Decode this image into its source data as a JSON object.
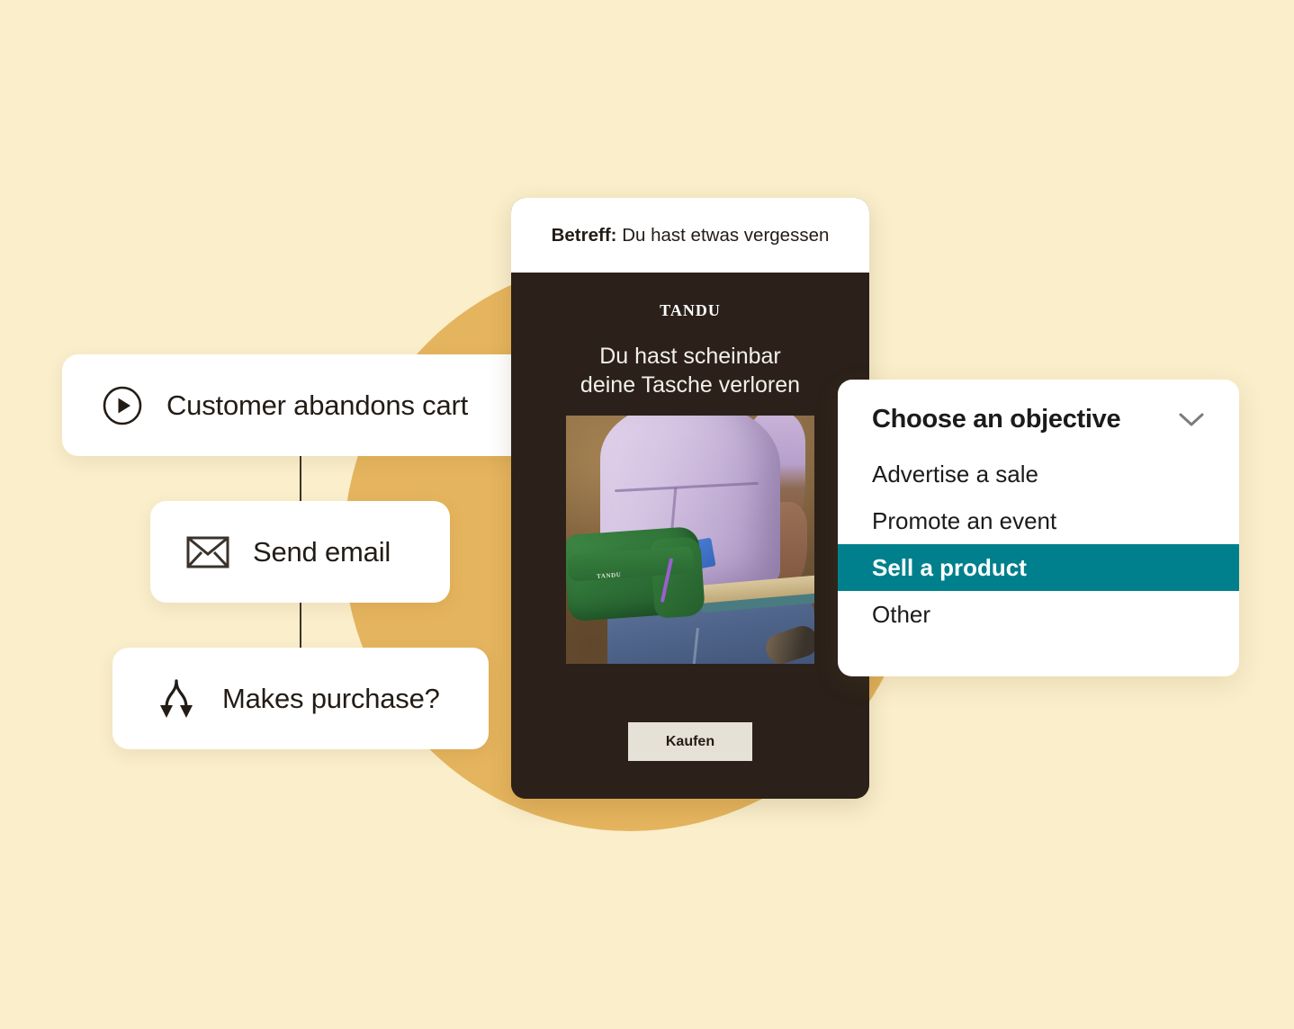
{
  "theme": {
    "background": "#FAEECB",
    "accent_circle": "#E5B45E",
    "email_dark": "#2B211A",
    "highlight_teal": "#00808C",
    "card_white": "#FFFFFF",
    "cta_bg": "#E6E1D7"
  },
  "flow": {
    "cards": [
      {
        "icon": "play-circle-icon",
        "label": "Customer abandons cart"
      },
      {
        "icon": "envelope-icon",
        "label": "Send email"
      },
      {
        "icon": "branch-arrows-icon",
        "label": "Makes purchase?"
      }
    ]
  },
  "email_preview": {
    "subject_label": "Betreff:",
    "subject_value": "Du hast etwas vergessen",
    "brand": "TANDU",
    "headline_line1": "Du hast scheinbar",
    "headline_line2": "deine Tasche verloren",
    "product_image_alt": "Cyclist wearing green TANDU hip bag",
    "bag_logo": "TANDU",
    "cta_label": "Kaufen"
  },
  "objective_dropdown": {
    "title": "Choose an objective",
    "chevron_icon": "chevron-down-icon",
    "options": [
      {
        "label": "Advertise a sale",
        "selected": false
      },
      {
        "label": "Promote an event",
        "selected": false
      },
      {
        "label": "Sell a product",
        "selected": true
      },
      {
        "label": "Other",
        "selected": false
      }
    ]
  }
}
